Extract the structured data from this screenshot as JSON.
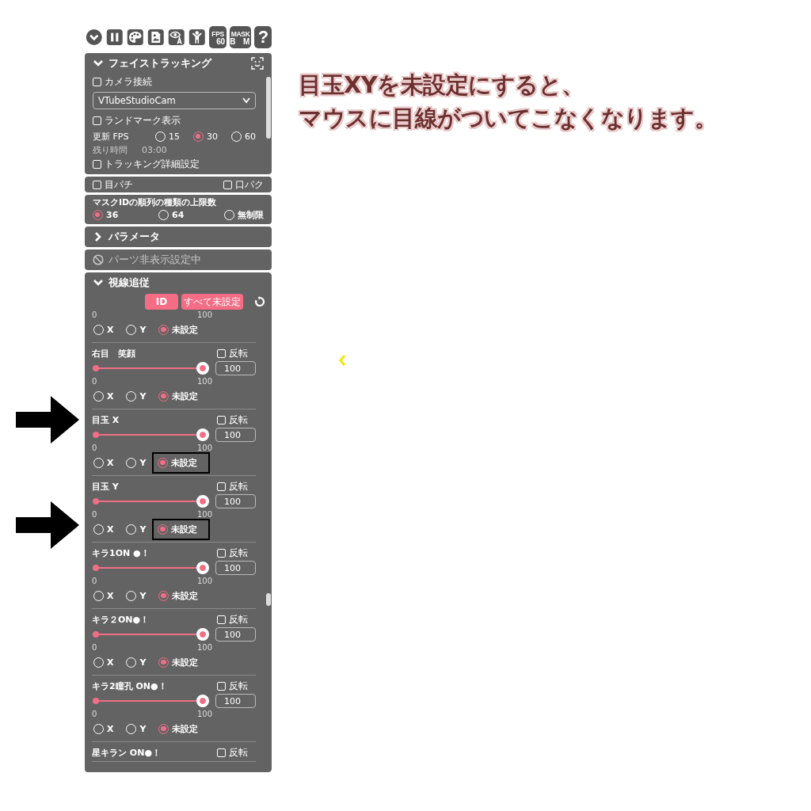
{
  "toolbar": [
    {
      "kind": "icon"
    },
    {
      "kind": "icon"
    },
    {
      "kind": "icon"
    },
    {
      "kind": "icon"
    },
    {
      "kind": "icon"
    },
    {
      "kind": "icon"
    },
    {
      "kind": "text",
      "lines": [
        "FPS",
        "60"
      ]
    },
    {
      "kind": "text",
      "lines": [
        "MASK",
        "B　M"
      ]
    },
    {
      "kind": "text",
      "lines": [
        "?"
      ]
    }
  ],
  "face_tracking": {
    "title": "フェイストラッキング",
    "expanded": true,
    "camera": {
      "label": "カメラ接続",
      "checked": false
    },
    "camera_select": {
      "value": "VTubeStudioCam"
    },
    "landmarks": {
      "label": "ランドマーク表示",
      "checked": false
    },
    "fps": {
      "label": "更新 FPS",
      "options": [
        {
          "label": "15",
          "selected": false
        },
        {
          "label": "30",
          "selected": true
        },
        {
          "label": "60",
          "selected": false
        }
      ]
    },
    "remaining": {
      "label": "残り時間",
      "value": "03:00"
    },
    "details": {
      "label": "トラッキング詳細設定",
      "checked": false
    }
  },
  "blink_lip": [
    {
      "label": "目パチ",
      "checked": false
    },
    {
      "label": "口パク",
      "checked": false
    }
  ],
  "mask_limit": {
    "label": "マスクIDの順列の種類の上限数",
    "options": [
      {
        "label": "36",
        "selected": true
      },
      {
        "label": "64",
        "selected": false
      },
      {
        "label": "無制限",
        "selected": false
      }
    ]
  },
  "parameters": {
    "title": "パラメータ",
    "expanded": false
  },
  "hidden_parts": {
    "title": "パーツ非表示設定中",
    "disabled": true
  },
  "gaze": {
    "title": "視線追従",
    "expanded": true,
    "buttons": [
      "ID",
      "すべて未設定"
    ],
    "items": [
      {
        "axis_arrow": false,
        "min": "0",
        "max": "100",
        "axis": [
          {
            "label": "X",
            "selected": false,
            "boxed": false
          },
          {
            "label": "Y",
            "selected": false,
            "boxed": false
          },
          {
            "label": "未設定",
            "selected": true,
            "boxed": false
          }
        ]
      },
      {
        "title": "右目　笑顔",
        "title_arrow": false,
        "axis_arrow": false,
        "flip": {
          "label": "反転",
          "checked": false
        },
        "level": 1,
        "value": "100",
        "min": "0",
        "max": "100",
        "axis": [
          {
            "label": "X",
            "selected": false,
            "boxed": false
          },
          {
            "label": "Y",
            "selected": false,
            "boxed": false
          },
          {
            "label": "未設定",
            "selected": true,
            "boxed": false
          }
        ]
      },
      {
        "title": "目玉 X",
        "title_arrow": true,
        "axis_arrow": false,
        "flip": {
          "label": "反転",
          "checked": false
        },
        "level": 1,
        "value": "100",
        "min": "0",
        "max": "100",
        "axis": [
          {
            "label": "X",
            "selected": false,
            "boxed": false
          },
          {
            "label": "Y",
            "selected": false,
            "boxed": false
          },
          {
            "label": "未設定",
            "selected": true,
            "boxed": true
          }
        ]
      },
      {
        "title": "目玉 Y",
        "title_arrow": false,
        "axis_arrow": true,
        "flip": {
          "label": "反転",
          "checked": false
        },
        "level": 1,
        "value": "100",
        "min": "0",
        "max": "100",
        "axis": [
          {
            "label": "X",
            "selected": false,
            "boxed": false
          },
          {
            "label": "Y",
            "selected": false,
            "boxed": false
          },
          {
            "label": "未設定",
            "selected": true,
            "boxed": true
          }
        ]
      },
      {
        "title": "キラ1ON ●！",
        "title_arrow": false,
        "axis_arrow": false,
        "flip": {
          "label": "反転",
          "checked": false
        },
        "level": 1,
        "value": "100",
        "min": "0",
        "max": "100",
        "axis": [
          {
            "label": "X",
            "selected": false,
            "boxed": false
          },
          {
            "label": "Y",
            "selected": false,
            "boxed": false
          },
          {
            "label": "未設定",
            "selected": true,
            "boxed": false
          }
        ]
      },
      {
        "title": "キラ２ON●！",
        "title_arrow": false,
        "axis_arrow": false,
        "flip": {
          "label": "反転",
          "checked": false
        },
        "level": 1,
        "value": "100",
        "min": "0",
        "max": "100",
        "axis": [
          {
            "label": "X",
            "selected": false,
            "boxed": false
          },
          {
            "label": "Y",
            "selected": false,
            "boxed": false
          },
          {
            "label": "未設定",
            "selected": true,
            "boxed": false
          }
        ]
      },
      {
        "title": "キラ2瞳孔 ON●！",
        "title_arrow": false,
        "axis_arrow": false,
        "flip": {
          "label": "反転",
          "checked": false
        },
        "level": 1,
        "value": "100",
        "min": "0",
        "max": "100",
        "axis": [
          {
            "label": "X",
            "selected": false,
            "boxed": false
          },
          {
            "label": "Y",
            "selected": false,
            "boxed": false
          },
          {
            "label": "未設定",
            "selected": true,
            "boxed": false
          }
        ]
      },
      {
        "title": "星キラン ON●！",
        "title_arrow": false,
        "flip": {
          "label": "反転",
          "checked": false
        }
      }
    ]
  },
  "caption": [
    "目玉XYを未設定にすると、",
    "マウスに目線がついてこなくなります。"
  ]
}
